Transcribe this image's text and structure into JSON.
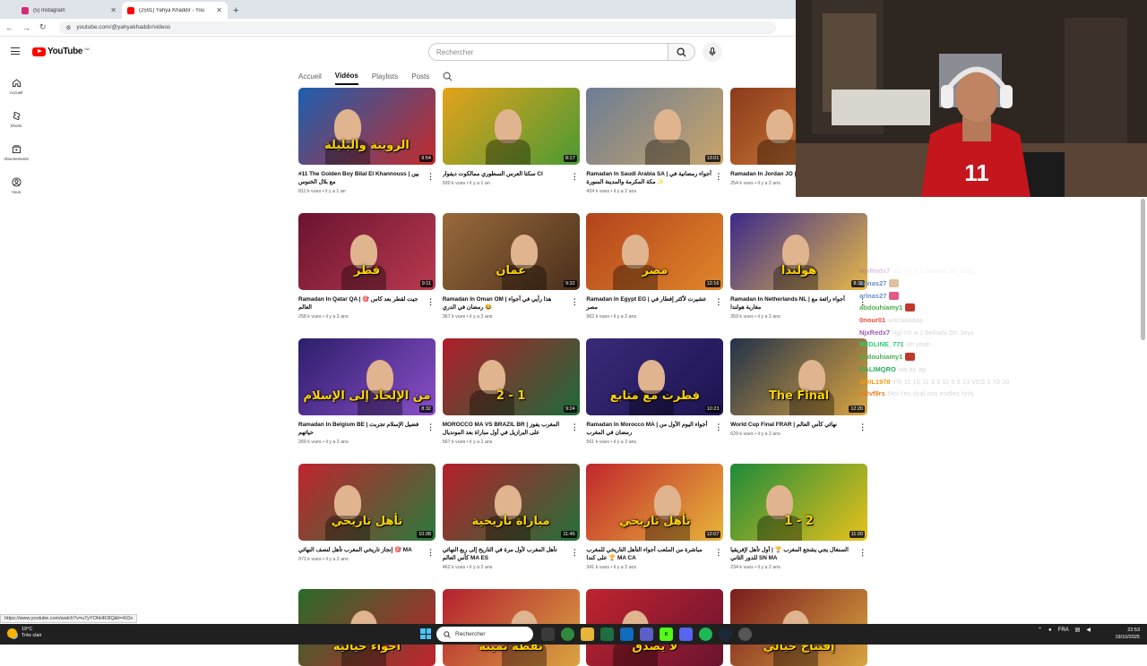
{
  "browser": {
    "tabs": [
      {
        "title": "(5) Instagram",
        "color": "#d62976"
      },
      {
        "title": "(2591) Yahya Khaddir - You",
        "color": "#ff0000"
      }
    ],
    "url": "youtube.com/@yahyakhaddir/videos"
  },
  "youtube": {
    "logo_text": "YouTube",
    "country_code": "MA",
    "search_placeholder": "Rechercher"
  },
  "guide": [
    "Accueil",
    "Shorts",
    "Abonnements",
    "Vous"
  ],
  "channel_tabs": [
    "Accueil",
    "Vidéos",
    "Playlists",
    "Posts"
  ],
  "videos": [
    {
      "title": "#11 The Golden Boy Bilal El Khannouss | بين مع بلال الخنوس",
      "views": "811 k vues",
      "age": "il y a 1 an",
      "duration": "9:54",
      "thumb_text": "الروينة والبليلة",
      "bg": [
        "#1d5fb0",
        "#c42b2b"
      ]
    },
    {
      "title": "سكتا العرس السطوري ممالكوت ديفوار CI",
      "views": "930 k vues",
      "age": "il y a 1 an",
      "duration": "8:17",
      "thumb_text": "",
      "bg": [
        "#e5a21b",
        "#4a9a34"
      ]
    },
    {
      "title": "Ramadan In Saudi Arabia SA | أجواء رمضانية في مكة المكرمة والمدينة المنورة ✨",
      "views": "424 k vues",
      "age": "il y a 2 ans",
      "duration": "13:01",
      "thumb_text": "",
      "bg": [
        "#6c7d95",
        "#c9a46a"
      ]
    },
    {
      "title": "Ramadan In Jordan JO |",
      "views": "254 k vues",
      "age": "il y a 2 ans",
      "duration": "",
      "thumb_text": "",
      "bg": [
        "#8a3b1c",
        "#e08a3a"
      ]
    },
    {
      "title": "Ramadan In Qatar QA | 🎯 جيت لقطر بعد كاس العالم",
      "views": "258 k vues",
      "age": "il y a 2 ans",
      "duration": "9:11",
      "thumb_text": "قطر",
      "bg": [
        "#6b1330",
        "#b83a4f"
      ]
    },
    {
      "title": "Ramadan In Oman OM | هذا رأيي في أجواء رمضان في الدري 😂",
      "views": "367 k vues",
      "age": "il y a 2 ans",
      "duration": "9:32",
      "thumb_text": "عمان",
      "bg": [
        "#9a6a3b",
        "#4a2f1c"
      ]
    },
    {
      "title": "Ramadan In Egypt EG | عشيرت لأكثر إفطار في مصر",
      "views": "962 k vues",
      "age": "il y a 2 ans",
      "duration": "12:16",
      "thumb_text": "مصر",
      "bg": [
        "#b3431c",
        "#e0862a"
      ]
    },
    {
      "title": "Ramadan In Netherlands NL | أجواء رائعة مع مغاربة هولندا",
      "views": "359 k vues",
      "age": "il y a 2 ans",
      "duration": "8:28",
      "thumb_text": "هولندا",
      "bg": [
        "#3b2a8a",
        "#e6b94a"
      ]
    },
    {
      "title": "Ramadan In Belgium BE | فضيل الإسلام تجربت حياتهم",
      "views": "269 k vues",
      "age": "il y a 2 ans",
      "duration": "8:32",
      "thumb_text": "من الإلحاد إلى الإسلام",
      "bg": [
        "#2d1e6b",
        "#8a4fc9"
      ]
    },
    {
      "title": "MOROCCO MA VS BRAZIL BR | المغرب يفوز على البرازيل في أول مباراة بعد المونديال",
      "views": "567 k vues",
      "age": "il y a 2 ans",
      "duration": "9:24",
      "thumb_text": "2 - 1",
      "bg": [
        "#b01e2a",
        "#1d6b3a"
      ]
    },
    {
      "title": "Ramadan In Morocco MA | أجواء اليوم الأول من رمضان في المغرب",
      "views": "561 k vues",
      "age": "il y a 2 ans",
      "duration": "10:23",
      "thumb_text": "فطرت مع متابع",
      "bg": [
        "#3a2a7a",
        "#1d1450"
      ]
    },
    {
      "title": "World Cup Final FRAR | نهائي كأس العالم",
      "views": "629 k vues",
      "age": "il y a 2 ans",
      "duration": "12:20",
      "thumb_text": "The Final",
      "bg": [
        "#23324a",
        "#d9a441"
      ]
    },
    {
      "title": "إنجاز تاريخي المغرب تأهل لنصف النهائي 🎯 MA",
      "views": "971 k vues",
      "age": "il y a 2 ans",
      "duration": "10:38",
      "thumb_text": "تأهل تاريخي",
      "bg": [
        "#c0242f",
        "#2a7a3b"
      ]
    },
    {
      "title": "تأهل المغرب لأول مرة في التاريخ إلى ربع النهائي كأس العالم MA ES",
      "views": "462 k vues",
      "age": "il y a 2 ans",
      "duration": "11:45",
      "thumb_text": "مباراة تاريخية",
      "bg": [
        "#b5202b",
        "#24703a"
      ]
    },
    {
      "title": "مباشرة من الملعب أجواء التأهل التاريخي للمغرب على كندا 🏆 MA CA",
      "views": "341 k vues",
      "age": "il y a 2 ans",
      "duration": "12:07",
      "thumb_text": "تأهل تاريخي",
      "bg": [
        "#c1272d",
        "#e8b53a"
      ]
    },
    {
      "title": "السنغال يجي يشجع المغرب 🏆 | أول تأهل لإفريقيا للدور الثاني SN MA",
      "views": "234 k vues",
      "age": "il y a 2 ans",
      "duration": "11:20",
      "thumb_text": "1 - 2",
      "bg": [
        "#1e8a3a",
        "#e8c21c"
      ]
    },
    {
      "title": "",
      "views": "",
      "age": "",
      "duration": "",
      "thumb_text": "أجواء خيالية",
      "bg": [
        "#2a6b2a",
        "#c0242f"
      ]
    },
    {
      "title": "",
      "views": "",
      "age": "",
      "duration": "",
      "thumb_text": "نقطة ثمينة",
      "bg": [
        "#b52030",
        "#d9a441"
      ]
    },
    {
      "title": "",
      "views": "",
      "age": "",
      "duration": "",
      "thumb_text": "لا يصدق",
      "bg": [
        "#c0242f",
        "#6b1330"
      ]
    },
    {
      "title": "",
      "views": "",
      "age": "",
      "duration": "",
      "thumb_text": "إفتتاح خيالي",
      "bg": [
        "#7a1c1c",
        "#d9a441"
      ]
    }
  ],
  "chat": [
    {
      "user": "NjxRedx7",
      "msg": "ngl i'm a 1 beloahi 2th 3ays",
      "color": "#9b59b6",
      "faint": true
    },
    {
      "user": "arlnas27",
      "msg": "",
      "color": "#6b8fc9",
      "emote": "#e0c0a0"
    },
    {
      "user": "arlnas27",
      "msg": "",
      "color": "#6b8fc9",
      "emote": "#e05a8a"
    },
    {
      "user": "abdouhiamy1",
      "msg": "",
      "color": "#4caf50",
      "emote": "#c0392b"
    },
    {
      "user": "0nour01",
      "msg": "wahaaaaaa",
      "color": "#e74c3c"
    },
    {
      "user": "NjxRedx7",
      "msg": "ngl i'm a 1 beloahi 2th 3ays",
      "color": "#9b59b6"
    },
    {
      "user": "REDLINE_771",
      "msg": "ah yeah",
      "color": "#2ecc71"
    },
    {
      "user": "abdouhiamy1",
      "msg": "",
      "color": "#4caf50",
      "emote": "#c0392b"
    },
    {
      "user": "KALIMQRO",
      "msg": "wa ay ag",
      "color": "#27ae60"
    },
    {
      "user": "AOIL1978",
      "msg": "FR 11 10 11 3 5 11 5 8 13 VES 1 70 10",
      "color": "#f39c12"
    },
    {
      "user": "m0vf9rs",
      "msg": "Moi t'es dyal moi endles hnhj",
      "color": "#e67e22"
    }
  ],
  "status_url": "https://www.youtube.com/watch?v=u7yYOhHR3IQ&t=410s",
  "taskbar": {
    "temp": "19°C",
    "weather": "Très clair",
    "search": "Rechercher",
    "lang": "FRA",
    "time": "22:53",
    "date": "19/10/2025"
  }
}
